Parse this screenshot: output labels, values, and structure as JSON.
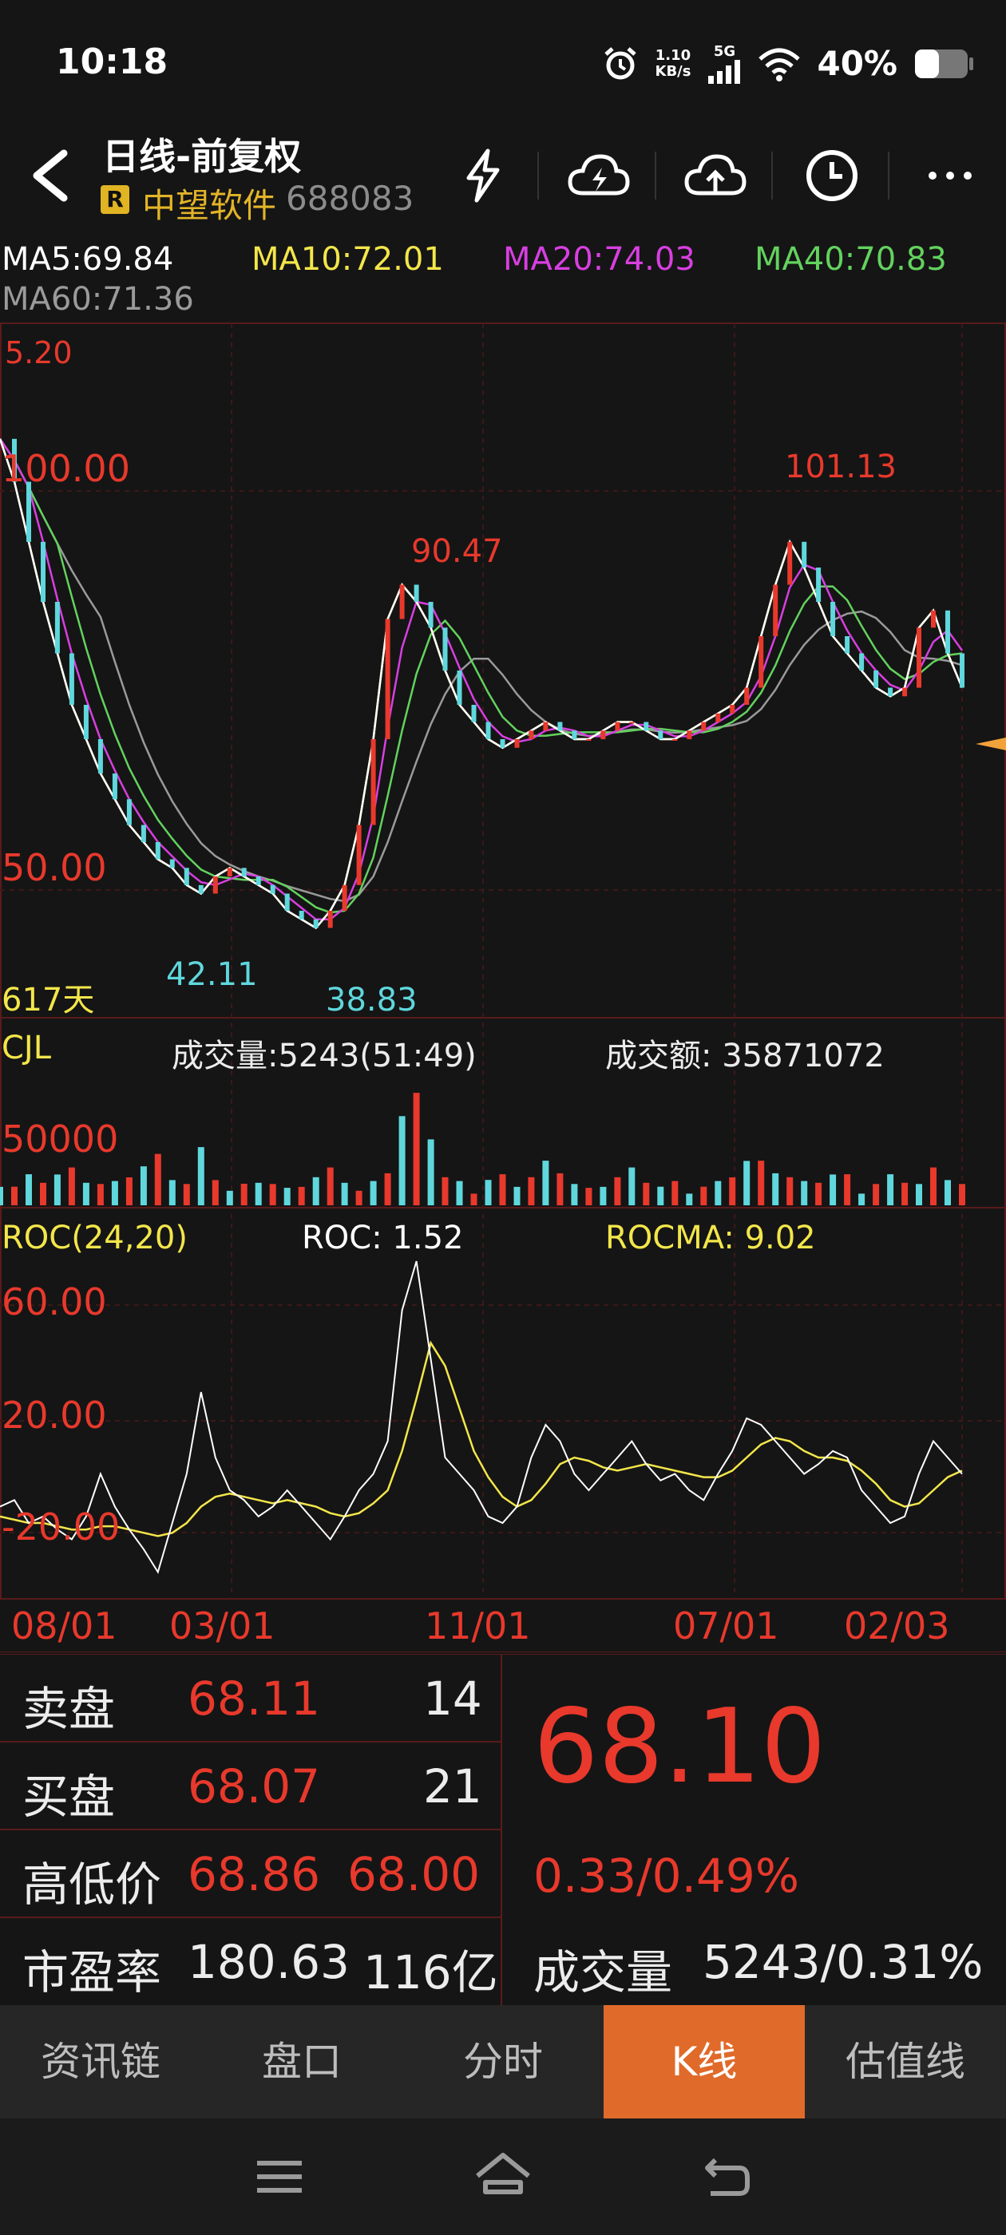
{
  "status_bar": {
    "time": "10:18",
    "net_speed_value": "1.10",
    "net_speed_unit": "KB/s",
    "network": "5G",
    "battery": "40%"
  },
  "header": {
    "title": "日线-前复权",
    "badge": "R",
    "stock_name": "中望软件",
    "stock_code": "688083",
    "icons": [
      "lightning-icon",
      "cloud-download-icon",
      "cloud-upload-icon",
      "clock-icon",
      "more-icon"
    ]
  },
  "ma_legend": {
    "ma5": "MA5:69.84",
    "ma10": "MA10:72.01",
    "ma20": "MA20:74.03",
    "ma40": "MA40:70.83",
    "ma60": "MA60:71.36"
  },
  "colors": {
    "up": "#e8392c",
    "down": "#5fd7dd",
    "ma5": "#ffffff",
    "ma10": "#f3e64a",
    "ma20": "#d83fe1",
    "ma40": "#63d25e",
    "ma60": "#9a9a9a",
    "accent": "#e06a2a",
    "gold": "#e2b428"
  },
  "kline_panel": {
    "top_label": "5.20",
    "y_label_high": "100.00",
    "y_label_low": "50.00",
    "annotations": {
      "a1": "90.47",
      "a2": "101.13",
      "a3": "42.11",
      "a4": "38.83"
    },
    "days": "617天"
  },
  "volume_panel": {
    "name": "CJL",
    "volume": "成交量:5243(51:49)",
    "amount": "成交额: 35871072",
    "y_label": "50000"
  },
  "roc_panel": {
    "name": "ROC(24,20)",
    "roc": "ROC: 1.52",
    "rocma": "ROCMA: 9.02",
    "y_labels": [
      "60.00",
      "20.00",
      "-20.00"
    ]
  },
  "x_axis": [
    "08/01",
    "03/01",
    "11/01",
    "07/01",
    "02/03"
  ],
  "chart_data": {
    "type": "line",
    "price_annotations": {
      "high": 101.13,
      "mid_high": 90.47,
      "low": 38.83,
      "mid_low": 42.11
    },
    "price_ylim": [
      30,
      110
    ],
    "price_series_close": [
      97,
      92,
      85,
      78,
      72,
      66,
      62,
      58,
      55,
      52,
      50,
      48,
      47,
      45,
      44,
      46,
      47,
      46,
      45,
      44,
      42,
      41,
      40,
      42,
      45,
      52,
      62,
      76,
      80,
      78,
      75,
      70,
      66,
      64,
      62,
      61,
      62,
      63,
      64,
      63,
      62,
      62,
      63,
      64,
      64,
      63,
      62,
      62,
      63,
      64,
      65,
      66,
      68,
      74,
      80,
      85,
      82,
      78,
      74,
      72,
      70,
      68,
      67,
      68,
      75,
      77,
      72,
      68
    ],
    "volume_ylim": [
      0,
      70000
    ],
    "roc_ylim": [
      -30,
      70
    ],
    "roc_series": [
      -5,
      -3,
      -10,
      -8,
      -12,
      -15,
      -8,
      5,
      -5,
      -12,
      -18,
      -25,
      -10,
      5,
      30,
      10,
      0,
      -3,
      -8,
      -5,
      0,
      -5,
      -10,
      -15,
      -8,
      0,
      5,
      15,
      55,
      70,
      40,
      10,
      5,
      0,
      -8,
      -10,
      -5,
      10,
      20,
      15,
      5,
      0,
      5,
      10,
      15,
      8,
      3,
      5,
      0,
      -3,
      5,
      12,
      22,
      20,
      15,
      10,
      5,
      8,
      12,
      10,
      0,
      -5,
      -10,
      -8,
      5,
      15,
      10,
      5
    ],
    "rocma_series": [
      -8,
      -9,
      -10,
      -10,
      -11,
      -12,
      -12,
      -11,
      -11,
      -12,
      -13,
      -14,
      -13,
      -10,
      -5,
      -2,
      -1,
      -2,
      -3,
      -4,
      -3,
      -4,
      -5,
      -7,
      -8,
      -7,
      -4,
      0,
      12,
      28,
      45,
      38,
      25,
      12,
      4,
      -2,
      -5,
      -3,
      2,
      8,
      10,
      9,
      7,
      6,
      7,
      8,
      7,
      6,
      5,
      4,
      4,
      6,
      10,
      14,
      16,
      15,
      12,
      10,
      10,
      9,
      6,
      2,
      -3,
      -5,
      -4,
      0,
      4,
      6
    ]
  },
  "quote": {
    "sell_label": "卖盘",
    "sell_price": "68.11",
    "sell_qty": "14",
    "buy_label": "买盘",
    "buy_price": "68.07",
    "buy_qty": "21",
    "hl_label": "高低价",
    "high": "68.86",
    "low": "68.00",
    "pe_label": "市盈率",
    "pe": "180.63",
    "cap": "116亿",
    "last_price": "68.10",
    "change": "0.33/0.49%",
    "vol_label": "成交量",
    "vol_value": "5243/0.31%"
  },
  "tabs": [
    "资讯链",
    "盘口",
    "分时",
    "K线",
    "估值线"
  ]
}
